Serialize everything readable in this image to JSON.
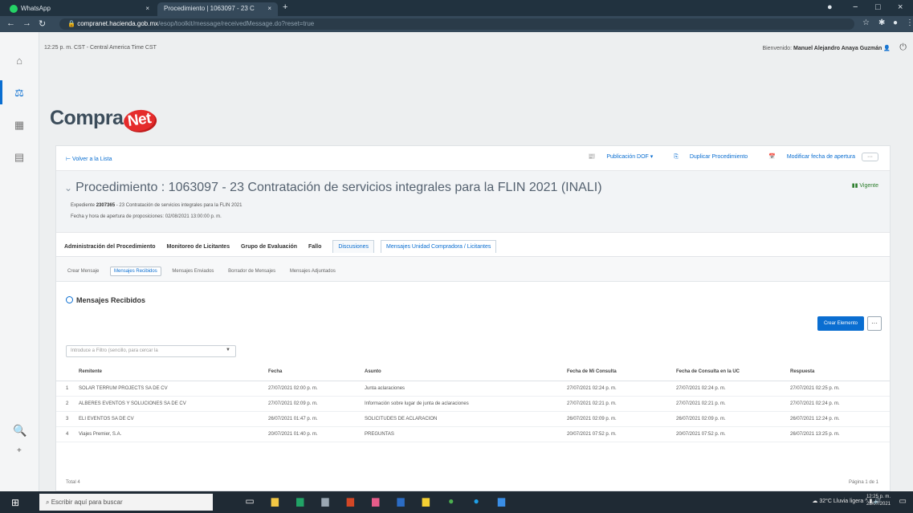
{
  "browser": {
    "tabs": [
      {
        "title": "WhatsApp",
        "close": "×"
      },
      {
        "title": "Procedimiento | 1063097 - 23 C",
        "close": "×"
      }
    ],
    "newtab": "+",
    "window_controls": {
      "minimize": "−",
      "maximize": "□",
      "close": "×"
    },
    "url": {
      "host": "compranet.hacienda.gob.mx",
      "path": "/esop/toolkit/message/receivedMessage.do?reset=true"
    }
  },
  "page": {
    "time_info": "12:25 p. m. CST - Central America Time CST",
    "welcome_prefix": "Bienvenido:",
    "user_name": "Manuel Alejandro Anaya Guzmán",
    "logo_text": "Compra",
    "logo_badge": "Net",
    "back_link": "Volver a la Lista",
    "actions": [
      "Publicación DOF",
      "Duplicar Procedimiento",
      "Modificar fecha de apertura"
    ],
    "more": "···",
    "title": "Procedimiento : 1063097 - 23 Contratación de servicios integrales para la FLIN 2021 (INALI)",
    "expediente_label": "Expediente",
    "expediente_num": "2307365",
    "expediente_desc": "- 23 Contratación de servicios integrales para la FLIN 2021",
    "fecha_apertura": "Fecha y hora de apertura de proposiciones: 02/08/2021 13:00:00 p. m.",
    "status": "Vigente",
    "main_tabs": [
      {
        "label": "Administración del Procedimiento",
        "state": "normal"
      },
      {
        "label": "Monitoreo de Licitantes",
        "state": "normal"
      },
      {
        "label": "Grupo de Evaluación",
        "state": "normal"
      },
      {
        "label": "Fallo",
        "state": "normal"
      },
      {
        "label": "Discusiones",
        "state": "selected"
      },
      {
        "label": "Mensajes Unidad Compradora / Licitantes",
        "state": "link"
      }
    ],
    "sub_tabs": [
      {
        "label": "Crear Mensaje",
        "selected": false
      },
      {
        "label": "Mensajes Recibidos",
        "selected": true
      },
      {
        "label": "Mensajes Enviados",
        "selected": false
      },
      {
        "label": "Borrador de Mensajes",
        "selected": false
      },
      {
        "label": "Mensajes Adjuntados",
        "selected": false
      }
    ],
    "section_title": "Mensajes Recibidos",
    "create_button": "Crear Elemento",
    "filter_placeholder": "Introduce a Filtro (sencillo, para cercar la",
    "columns": [
      "Remitente",
      "Fecha",
      "Asunto",
      "Fecha de Mi Consulta",
      "Fecha de Consulta en la UC",
      "Respuesta"
    ],
    "rows": [
      {
        "n": "1",
        "remitente": "SOLAR TERRUM PROJECTS SA DE CV",
        "fecha": "27/07/2021 02:00 p. m.",
        "asunto": "Junta aclaraciones",
        "consulta": "27/07/2021 02:24 p. m.",
        "consulta_uc": "27/07/2021 02:24 p. m.",
        "respuesta": "27/07/2021 02:25 p. m."
      },
      {
        "n": "2",
        "remitente": "ALBERES EVENTOS Y SOLUCIONES SA DE CV",
        "fecha": "27/07/2021 02:09 p. m.",
        "asunto": "Información sobre lugar de junta de aclaraciones",
        "consulta": "27/07/2021 02:21 p. m.",
        "consulta_uc": "27/07/2021 02:21 p. m.",
        "respuesta": "27/07/2021 02:24 p. m."
      },
      {
        "n": "3",
        "remitente": "ELI EVENTOS SA DE CV",
        "fecha": "26/07/2021 01:47 p. m.",
        "asunto": "SOLICITUDES DE ACLARACION",
        "consulta": "26/07/2021 02:09 p. m.",
        "consulta_uc": "26/07/2021 02:09 p. m.",
        "respuesta": "26/07/2021 12:24 p. m."
      },
      {
        "n": "4",
        "remitente": "Viajes Premier, S.A.",
        "fecha": "20/07/2021 01:40 p. m.",
        "asunto": "PREGUNTAS",
        "consulta": "20/07/2021 07:52 p. m.",
        "consulta_uc": "20/07/2021 07:52 p. m.",
        "respuesta": "26/07/2021 13:25 p. m."
      }
    ],
    "total": "Total 4",
    "pagination": "Página 1 de 1"
  },
  "taskbar": {
    "search_placeholder": "Escribir aquí para buscar",
    "weather": "32°C  Lluvia ligera",
    "time": "12:25 p. m.",
    "date": "28/07/2021"
  },
  "colors": {
    "accent": "#0a6ed1",
    "brand_red": "#e52b2b",
    "status_green": "#2b7d2b"
  }
}
